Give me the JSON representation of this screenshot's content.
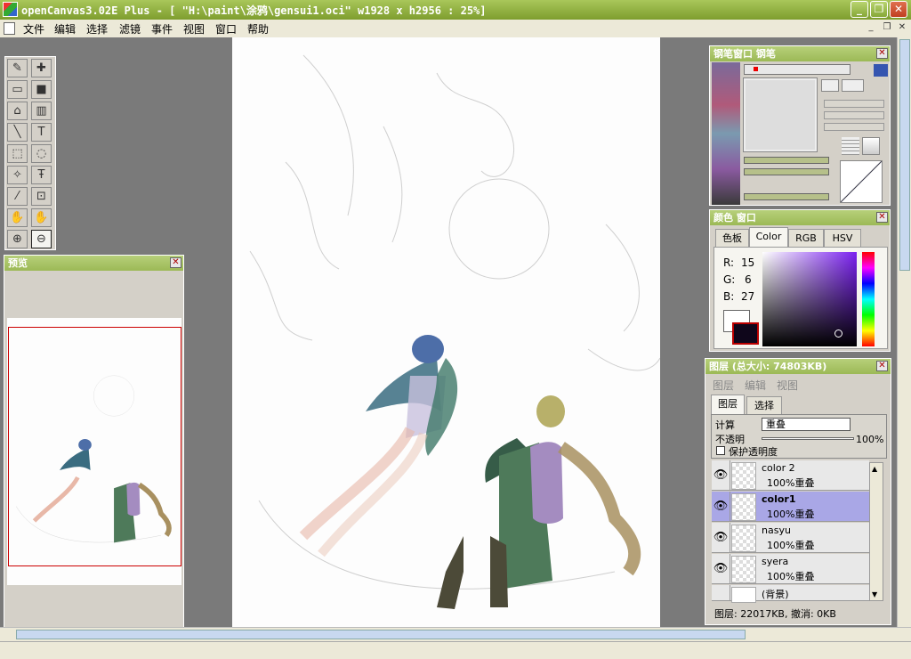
{
  "window": {
    "title": "openCanvas3.02E Plus - [ \"H:\\paint\\涂鸦\\gensui1.oci\" w1928 x h2956 : 25%]",
    "btn_min": "_",
    "btn_max": "❐",
    "btn_close": "✕"
  },
  "menu": {
    "items": [
      "文件",
      "编辑",
      "选择",
      "滤镜",
      "事件",
      "视图",
      "窗口",
      "帮助"
    ],
    "mdi_min": "_",
    "mdi_restore": "❐",
    "mdi_close": "✕"
  },
  "toolbox": {
    "tools": [
      "pen",
      "move",
      "rectangle",
      "fill-rect",
      "bucket",
      "gradient",
      "line",
      "text",
      "rect-select",
      "lasso-select",
      "magic-wand",
      "text-select",
      "eyedropper",
      "crop",
      "hand",
      "rotate-hand",
      "zoom-in",
      "zoom-out"
    ],
    "glyphs": [
      "✎",
      "✚",
      "▭",
      "■",
      "⌂",
      "▥",
      "╲",
      "T",
      "⬚",
      "◌",
      "✧",
      "Ŧ",
      "⁄",
      "⊡",
      "✋",
      "✋",
      "⊕",
      "⊖"
    ]
  },
  "preview": {
    "title": "预览",
    "close": "✕"
  },
  "brush_panel": {
    "title": "钢笔窗口   钢笔",
    "close": "✕"
  },
  "color_panel": {
    "title": "颜色 窗口",
    "close": "✕",
    "tabs": [
      "色板",
      "Color",
      "RGB",
      "HSV"
    ],
    "active_tab": "Color",
    "r_label": "R:",
    "r_value": "15",
    "g_label": "G:",
    "g_value": "6",
    "b_label": "B:",
    "b_value": "27",
    "fg_color": "#0f061b",
    "bg_color": "#ffffff"
  },
  "layer_panel": {
    "title": "图层 (总大小: 74803KB)",
    "close": "✕",
    "menu": [
      "图层",
      "编辑",
      "视图"
    ],
    "tabs": [
      "图层",
      "选择"
    ],
    "blend_label": "计算",
    "blend_value": "重叠",
    "opacity_label": "不透明",
    "opacity_value": "100%",
    "protect_label": "保护透明度",
    "layers": [
      {
        "name": "color 2",
        "mode": "100%重叠",
        "selected": false
      },
      {
        "name": "color1",
        "mode": "100%重叠",
        "selected": true
      },
      {
        "name": "nasyu",
        "mode": "100%重叠",
        "selected": false
      },
      {
        "name": "syera",
        "mode": "100%重叠",
        "selected": false
      },
      {
        "name": "(背景)",
        "mode": "",
        "selected": false
      }
    ],
    "status": "图层: 22017KB, 撤消: 0KB"
  },
  "colors": {
    "titlebar": "#8fae3f",
    "selected_layer": "#a9a7e6"
  }
}
